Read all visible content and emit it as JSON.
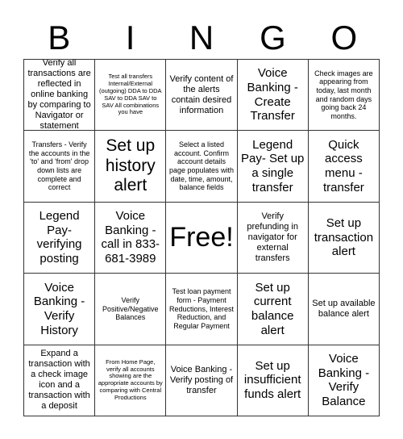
{
  "header": {
    "letters": [
      "B",
      "I",
      "N",
      "G",
      "O"
    ]
  },
  "cells": [
    "Verify all transactions are reflected in online banking by comparing to Navigator or statement",
    "Test all transfers Internal/External (outgoing) DDA to DDA SAV to DDA SAV to SAV All combinations you have",
    "Verify content of the alerts contain desired information",
    "Voice Banking - Create Transfer",
    "Check images are appearing from today, last month and random days going back 24 months.",
    "Transfers - Verify the accounts in the 'to' and 'from' drop down lists are complete and correct",
    "Set up history alert",
    "Select a listed account. Confirm account details page populates with date, time, amount, balance fields",
    "Legend Pay- Set up a single transfer",
    "Quick access menu - transfer",
    "Legend Pay- verifying posting",
    "Voice Banking - call in 833-681-3989",
    "Free!",
    "Verify prefunding in navigator for external transfers",
    "Set up transaction alert",
    "Voice Banking - Verify History",
    "Verify Positive/Negative Balances",
    "Test loan payment form - Payment Reductions, Interest Reduction, and Regular Payment",
    "Set up current balance alert",
    "Set up available balance alert",
    "Expand a transaction with a check image icon and a transaction with a deposit",
    "From Home Page, verify all accounts showing are the appropriate accounts by comparing with Central Productions",
    "Voice Banking - Verify posting of transfer",
    "Set up insufficient funds alert",
    "Voice Banking - Verify Balance"
  ]
}
